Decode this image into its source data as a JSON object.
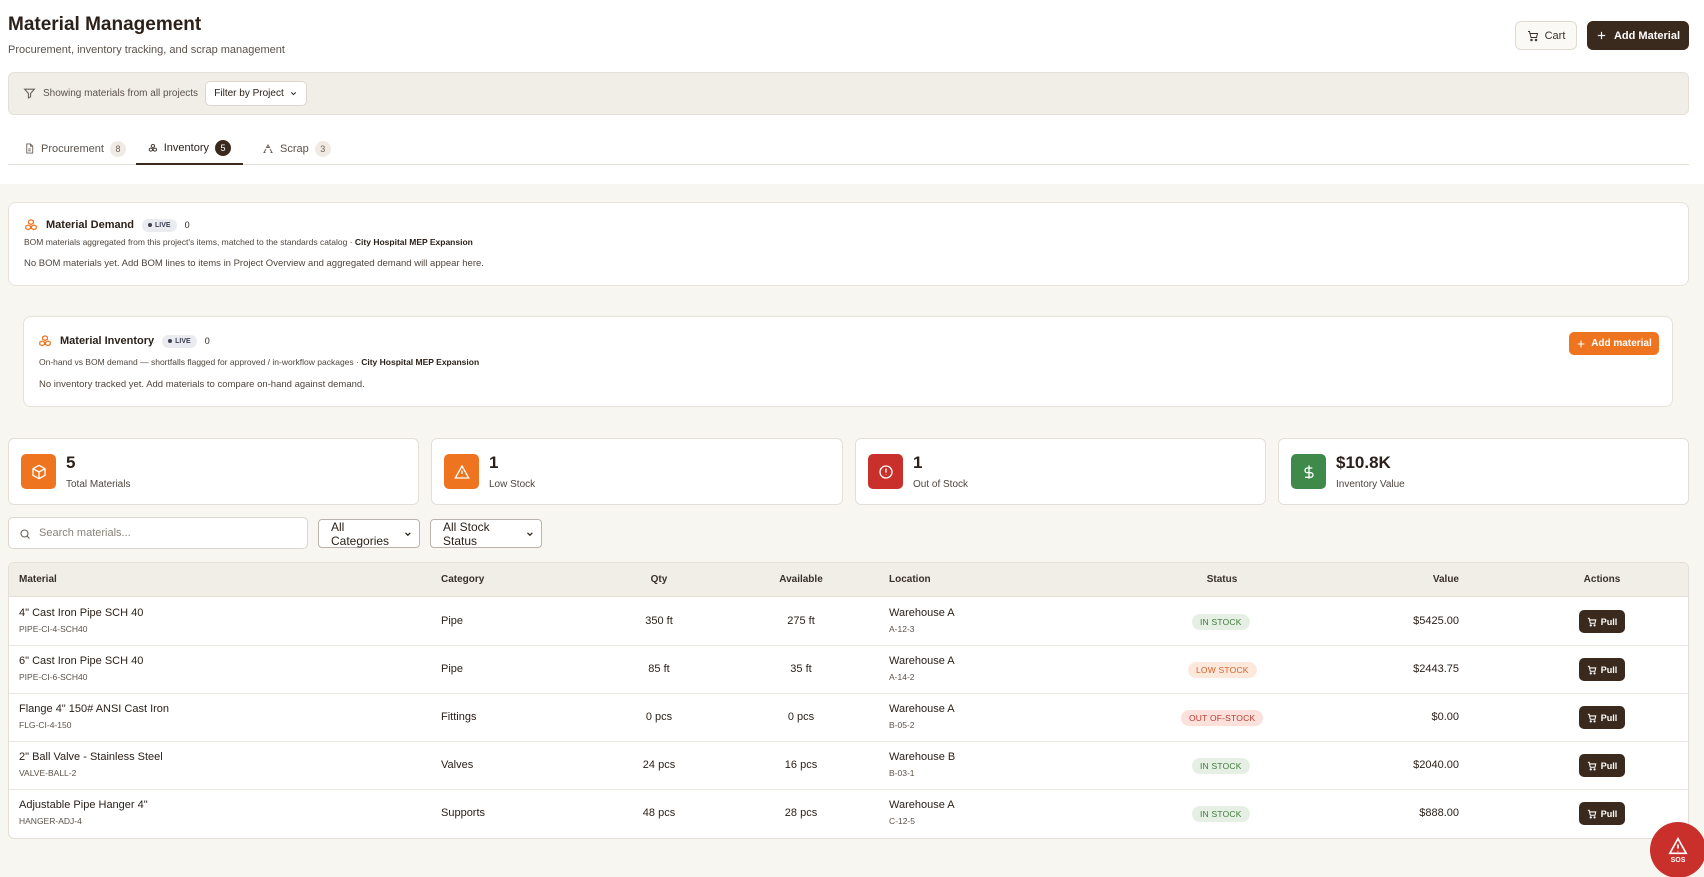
{
  "header": {
    "title": "Material Management",
    "subtitle": "Procurement, inventory tracking, and scrap management",
    "cart_label": "Cart",
    "add_material_label": "Add Material"
  },
  "filter": {
    "text": "Showing materials from all projects",
    "button_label": "Filter by Project"
  },
  "tabs": [
    {
      "label": "Procurement",
      "count": "8",
      "icon": "document-icon"
    },
    {
      "label": "Inventory",
      "count": "5",
      "icon": "boxes-icon",
      "active": true
    },
    {
      "label": "Scrap",
      "count": "3",
      "icon": "recycle-icon"
    }
  ],
  "demand_card": {
    "title": "Material Demand",
    "badge": "LIVE",
    "count": "0",
    "desc": "BOM materials aggregated from this project's items, matched to the standards catalog · ",
    "project": "City Hospital MEP Expansion",
    "empty": "No BOM materials yet. Add BOM lines to items in Project Overview and aggregated demand will appear here."
  },
  "inventory_card": {
    "title": "Material Inventory",
    "badge": "LIVE",
    "count": "0",
    "desc": "On-hand vs BOM demand — shortfalls flagged for approved / in-workflow packages · ",
    "project": "City Hospital MEP Expansion",
    "empty": "No inventory tracked yet. Add materials to compare on-hand against demand.",
    "add_label": "Add material"
  },
  "stats": [
    {
      "value": "5",
      "label": "Total Materials",
      "icon": "box-icon",
      "color": "#ee7420"
    },
    {
      "value": "1",
      "label": "Low Stock",
      "icon": "warning-icon",
      "color": "#ee7420"
    },
    {
      "value": "1",
      "label": "Out of Stock",
      "icon": "alert-circle-icon",
      "color": "#c9302c"
    },
    {
      "value": "$10.8K",
      "label": "Inventory Value",
      "icon": "dollar-icon",
      "color": "#3f8a4a"
    }
  ],
  "search": {
    "placeholder": "Search materials..."
  },
  "selects": {
    "category": "All Categories",
    "status": "All Stock Status"
  },
  "table": {
    "headers": {
      "material": "Material",
      "category": "Category",
      "qty": "Qty",
      "available": "Available",
      "location": "Location",
      "status": "Status",
      "value": "Value",
      "actions": "Actions"
    },
    "rows": [
      {
        "name": "4\" Cast Iron Pipe SCH 40",
        "code": "PIPE-CI-4-SCH40",
        "category": "Pipe",
        "qty": "350 ft",
        "available": "275 ft",
        "location": "Warehouse A",
        "bin": "A-12-3",
        "status": "IN STOCK",
        "status_type": "in",
        "value": "$5425.00",
        "action": "Pull"
      },
      {
        "name": "6\" Cast Iron Pipe SCH 40",
        "code": "PIPE-CI-6-SCH40",
        "category": "Pipe",
        "qty": "85 ft",
        "available": "35 ft",
        "location": "Warehouse A",
        "bin": "A-14-2",
        "status": "LOW STOCK",
        "status_type": "low",
        "value": "$2443.75",
        "action": "Pull"
      },
      {
        "name": "Flange 4\" 150# ANSI Cast Iron",
        "code": "FLG-CI-4-150",
        "category": "Fittings",
        "qty": "0 pcs",
        "available": "0 pcs",
        "location": "Warehouse A",
        "bin": "B-05-2",
        "status": "OUT OF-STOCK",
        "status_type": "out",
        "value": "$0.00",
        "action": "Pull"
      },
      {
        "name": "2\" Ball Valve - Stainless Steel",
        "code": "VALVE-BALL-2",
        "category": "Valves",
        "qty": "24 pcs",
        "available": "16 pcs",
        "location": "Warehouse B",
        "bin": "B-03-1",
        "status": "IN STOCK",
        "status_type": "in",
        "value": "$2040.00",
        "action": "Pull"
      },
      {
        "name": "Adjustable Pipe Hanger 4\"",
        "code": "HANGER-ADJ-4",
        "category": "Supports",
        "qty": "48 pcs",
        "available": "28 pcs",
        "location": "Warehouse A",
        "bin": "C-12-5",
        "status": "IN STOCK",
        "status_type": "in",
        "value": "$888.00",
        "action": "Pull"
      }
    ]
  },
  "sos": {
    "label": "SOS"
  }
}
